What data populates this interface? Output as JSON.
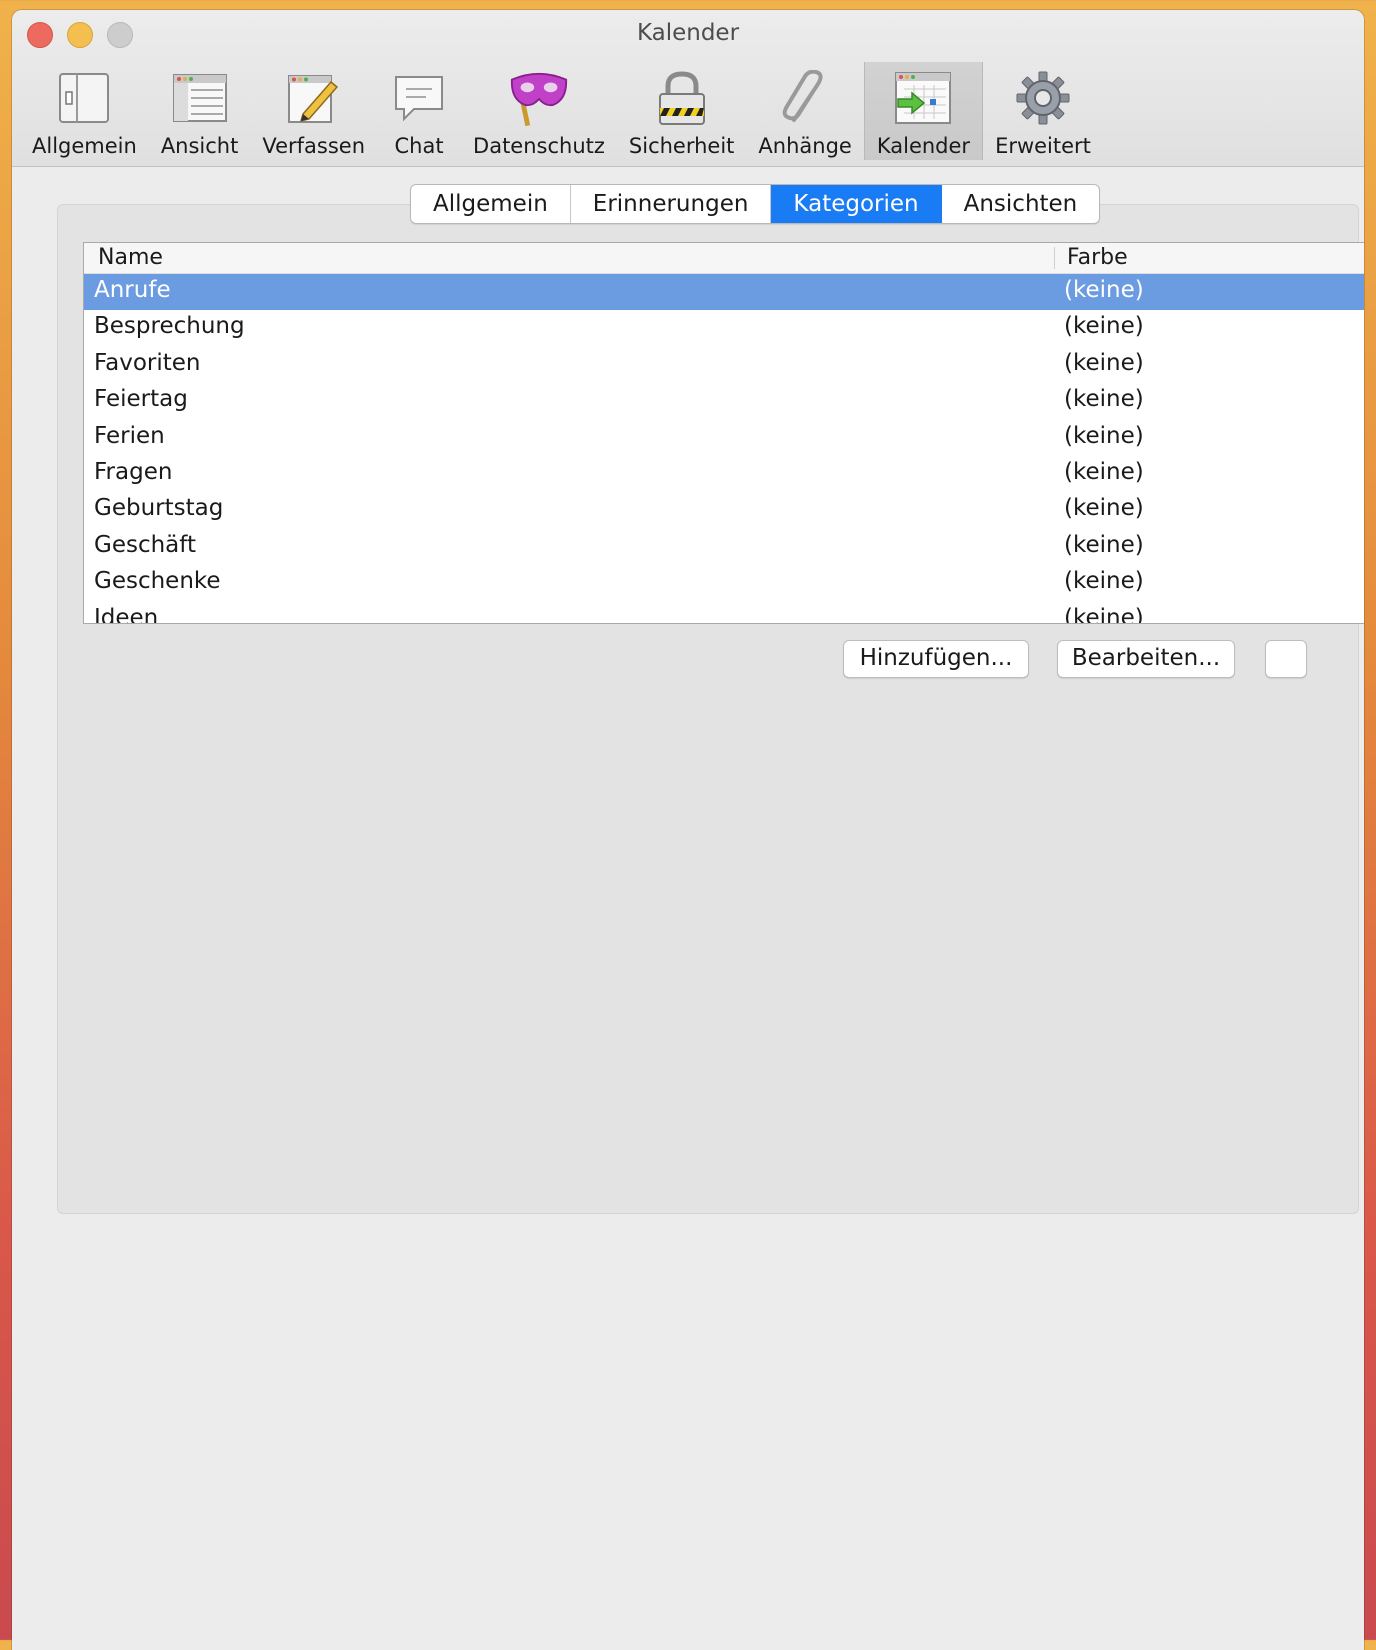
{
  "window": {
    "title": "Kalender"
  },
  "toolbar": {
    "items": [
      {
        "label": "Allgemein",
        "icon": "switch-panel-icon"
      },
      {
        "label": "Ansicht",
        "icon": "window-list-icon"
      },
      {
        "label": "Verfassen",
        "icon": "pencil-document-icon"
      },
      {
        "label": "Chat",
        "icon": "chat-bubble-icon"
      },
      {
        "label": "Datenschutz",
        "icon": "mask-icon"
      },
      {
        "label": "Sicherheit",
        "icon": "padlock-icon"
      },
      {
        "label": "Anhänge",
        "icon": "paperclip-icon"
      },
      {
        "label": "Kalender",
        "icon": "calendar-icon"
      },
      {
        "label": "Erweitert",
        "icon": "gear-icon"
      }
    ],
    "selected": "Kalender"
  },
  "tabs": [
    "Allgemein",
    "Erinnerungen",
    "Kategorien",
    "Ansichten"
  ],
  "active_tab": "Kategorien",
  "table": {
    "columns": {
      "name": "Name",
      "color": "Farbe"
    },
    "rows": [
      {
        "name": "Anrufe",
        "color": "(keine)",
        "selected": true
      },
      {
        "name": "Besprechung",
        "color": "(keine)"
      },
      {
        "name": "Favoriten",
        "color": "(keine)"
      },
      {
        "name": "Feiertag",
        "color": "(keine)"
      },
      {
        "name": "Ferien",
        "color": "(keine)"
      },
      {
        "name": "Fragen",
        "color": "(keine)"
      },
      {
        "name": "Geburtstag",
        "color": "(keine)"
      },
      {
        "name": "Geschäft",
        "color": "(keine)"
      },
      {
        "name": "Geschenke",
        "color": "(keine)"
      },
      {
        "name": "Ideen",
        "color": "(keine)"
      }
    ]
  },
  "buttons": {
    "add": "Hinzufügen...",
    "edit": "Bearbeiten...",
    "more": ""
  },
  "colors": {
    "accent": "#1a7cf5",
    "row_selected": "#6b9be0"
  }
}
